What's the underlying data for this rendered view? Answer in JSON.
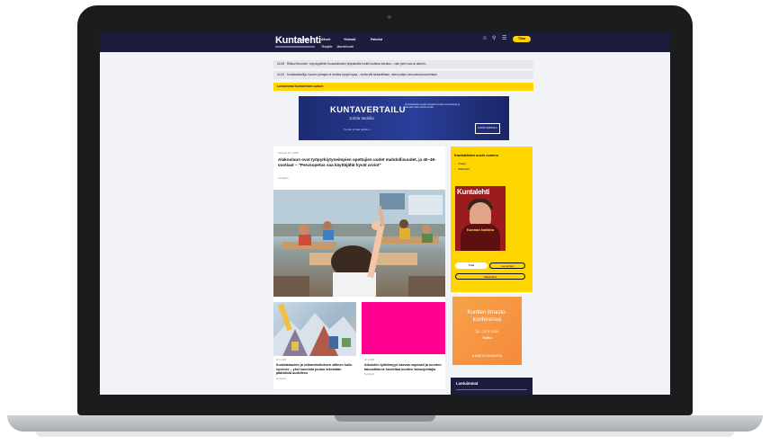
{
  "site": {
    "logo": "Kuntalehti",
    "nav": [
      "Etusivu",
      "Aiheet",
      "Yhteisöt",
      "Palvelut"
    ],
    "nav_sub": [
      "Tilaajalle",
      "Jäsenetuudet"
    ],
    "subscribe_label": "Tilaa",
    "icons": [
      "user-icon",
      "search-icon",
      "menu-icon"
    ]
  },
  "tickers": [
    {
      "time": "12.35",
      "text": "Riikka Kinnunen: Leposyytteille Kuusankosken työpaikoille luotiin luuttava toimitus – vain pieni osa on alueen..."
    },
    {
      "time": "12.22",
      "text": "Kuntatarkkailija: Nuoren johtajan ei tarvitse kysyä lupaa – mutta silti tarkastellaan, miten paljon neuvostoa kuunnellaan"
    }
  ],
  "notice": "Luetuimmat Kuntalehden uutiset",
  "ad": {
    "title": "KUNTAVERTAILU",
    "subtitle": "Johda tiedolla",
    "cta": "Tutustu ja tilaa palvelu »",
    "text": "Kuntavertailun avulla vertailet kuntasi tunnuslukuja ja talouden tilaa muihin kuntiin",
    "logo": "KUNTA VERTAILU"
  },
  "article": {
    "date": "Perjantai 20.1.2025",
    "headline": "Alakouluun ovat työpyrkiytyneimpien opettajien uudet mahdollisuudet, ja 40–49-vuotiaat – \"Perusopetus saa käyttäjältä hyvät arviot\"",
    "meta": "Kuntalehti"
  },
  "cards": [
    {
      "date": "20.1.2025",
      "headline": "Kuntatalouden ja velkarahoituksen välinen kuilu syvenee – yksi kunnista joutuu tekemään päätöksiä uudelleen",
      "meta": "Kuntalehti"
    },
    {
      "date": "20.1.2025",
      "headline": "Aikuisten työttömyys kasvaa nopeasti ja nuorten taloustilanne huolettaa kuntien talousjohtajia",
      "meta": "Kuntalehti"
    }
  ],
  "sidebar": {
    "title": "Kuntalehden uusin numero",
    "items": [
      "Tilaajat",
      "Näköislehti"
    ],
    "magazine_logo": "Kuntalehti",
    "magazine_caption": "Kunnan hallinto",
    "buttons": {
      "subscribe": "Tilaa",
      "read": "Lue lehteä",
      "digital": "Näköislehti"
    }
  },
  "ad2": {
    "line1": "Kuntien ilmasto-",
    "line2": "konferenssi",
    "dates": "21.–22.5.2025",
    "city": "Turku",
    "footer": "ILMASTO KUNNISSA"
  },
  "latest": {
    "title": "Luetuimmat"
  }
}
